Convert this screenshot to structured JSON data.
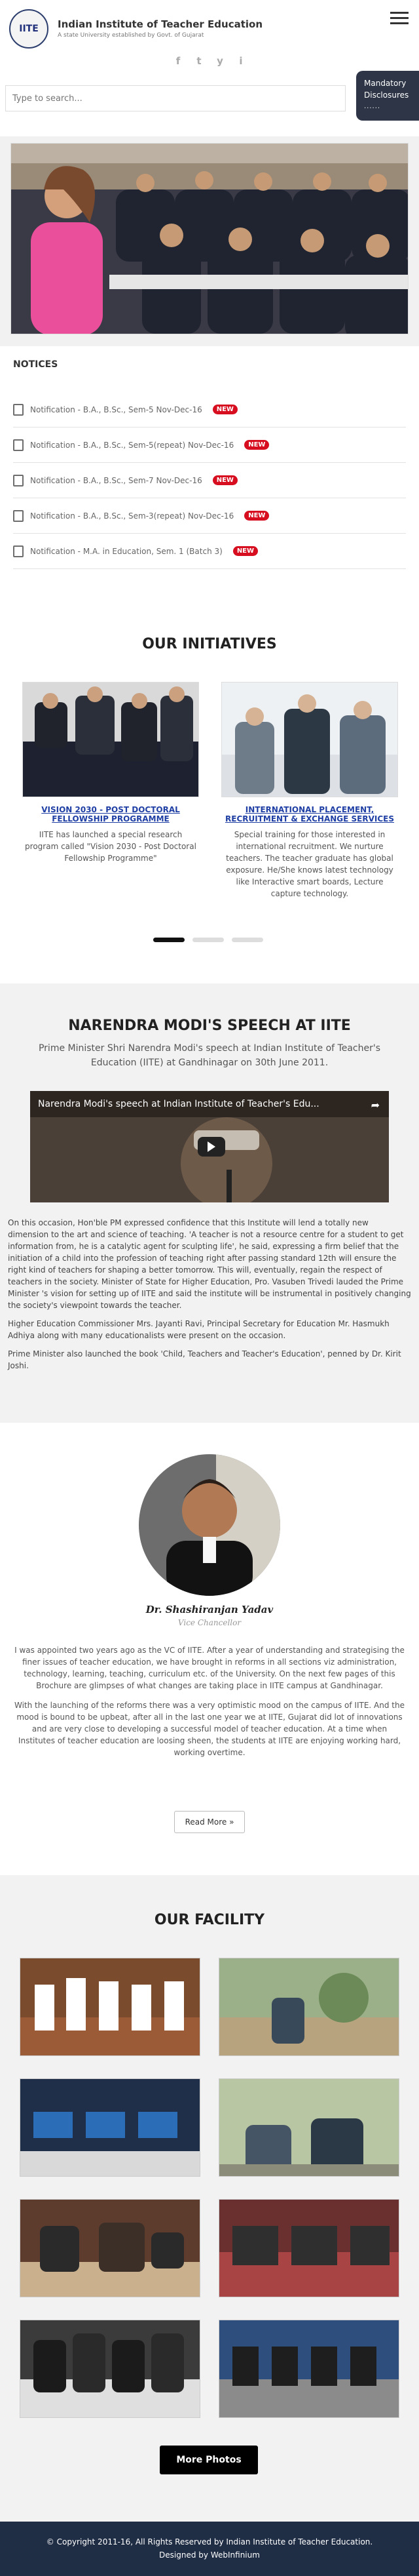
{
  "header": {
    "logo_text": "IITE",
    "brand_name": "Indian Institute of Teacher Education",
    "brand_sub": "A state University established by Govt. of Gujarat",
    "social": [
      "f",
      "t",
      "y",
      "i"
    ]
  },
  "search": {
    "placeholder": "Type to search..."
  },
  "mandatory": {
    "line1": "Mandatory",
    "line2": "Disclosures",
    "dots": "......"
  },
  "notices": {
    "title": "NOTICES",
    "items": [
      {
        "text": "Notification - B.A., B.Sc., Sem-5 Nov-Dec-16",
        "badge": "NEW"
      },
      {
        "text": "Notification - B.A., B.Sc., Sem-5(repeat) Nov-Dec-16",
        "badge": "NEW"
      },
      {
        "text": "Notification - B.A., B.Sc., Sem-7 Nov-Dec-16",
        "badge": "NEW"
      },
      {
        "text": "Notification - B.A., B.Sc., Sem-3(repeat) Nov-Dec-16",
        "badge": "NEW"
      },
      {
        "text": "Notification - M.A. in Education, Sem. 1 (Batch 3)",
        "badge": "NEW"
      }
    ]
  },
  "initiatives": {
    "title": "OUR INITIATIVES",
    "cards": [
      {
        "title": "VISION 2030 - POST DOCTORAL FELLOWSHIP PROGRAMME",
        "body": "IITE has launched a special research program called \"Vision 2030 - Post Doctoral Fellowship Programme\""
      },
      {
        "title": "INTERNATIONAL PLACEMENT, RECRUITMENT & EXCHANGE SERVICES",
        "body": "Special training for those interested in international recruitment. We nurture teachers. The teacher graduate has global exposure. He/She knows latest technology like Interactive smart boards, Lecture capture technology."
      }
    ]
  },
  "speech": {
    "title": "NARENDRA MODI'S SPEECH AT IITE",
    "subtitle": "Prime Minister Shri Narendra Modi's speech at Indian Institute of Teacher's Education (IITE) at Gandhinagar on 30th June 2011.",
    "video_title": "Narendra Modi's speech at Indian Institute of Teacher's Edu...",
    "paragraphs": [
      "On this occasion, Hon'ble PM expressed confidence that this Institute will lend a totally new dimension to the art and science of teaching. 'A teacher is not a resource centre for a student to get information from, he is a catalytic agent for sculpting life', he said, expressing a firm belief that the initiation of a child into the profession of teaching right after passing standard 12th will ensure the right kind of teachers for shaping a better tomorrow. This will, eventually, regain the respect of teachers in the society. Minister of State for Higher Education, Pro. Vasuben Trivedi lauded the Prime Minister 's vision for setting up of IITE and said the institute will be instrumental in positively changing the society's viewpoint towards the teacher.",
      "Higher Education Commissioner Mrs. Jayanti Ravi, Principal Secretary for Education Mr. Hasmukh Adhiya along with many educationalists were present on the occasion.",
      "Prime Minister also launched the book 'Child, Teachers and Teacher's Education', penned by Dr. Kirit Joshi."
    ]
  },
  "vc": {
    "name": "Dr. Shashiranjan Yadav",
    "role": "Vice Chancellor",
    "paragraphs": [
      "I was appointed two years ago as the VC of IITE. After a year of understanding and strategising the finer issues of teacher education, we have brought in reforms in all sections viz administration, technology, learning, teaching, curriculum etc. of the University. On the next few pages of this Brochure are glimpses of what changes are taking place in IITE campus at Gandhinagar.",
      "With the launching of the reforms there was a very optimistic mood on the campus of IITE. And the mood is bound to be upbeat, after all in the last one year we at IITE, Gujarat did lot of innovations and are very close to developing a successful model of teacher education. At a time when Institutes of teacher education are loosing sheen, the students at IITE are enjoying working hard, working overtime."
    ],
    "read_more": "Read More »"
  },
  "facility": {
    "title": "OUR FACILITY",
    "more_photos": "More Photos"
  },
  "footer": {
    "line1": "© Copyright 2011-16, All Rights Reserved by Indian Institute of Teacher Education.",
    "line2": "Designed by WebInfinium"
  }
}
